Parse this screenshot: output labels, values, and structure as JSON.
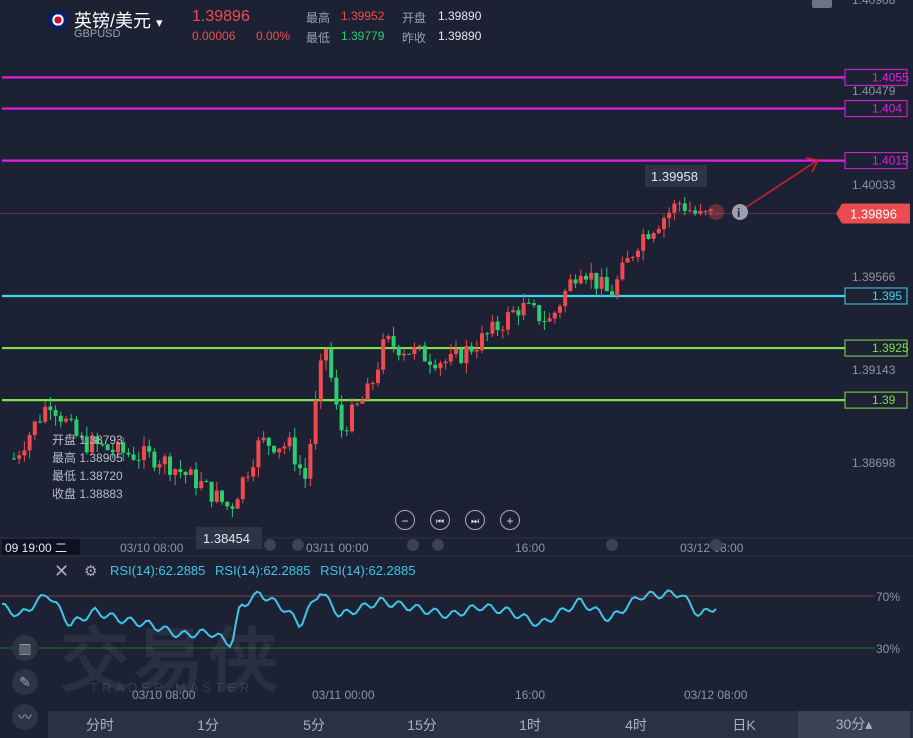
{
  "header": {
    "symbol_name": "英镑/美元",
    "symbol_dropdown": "▾",
    "symbol_code": "GBPUSD",
    "last_price": "1.39896",
    "change": "0.00006",
    "change_pct": "0.00%",
    "high_label": "最高",
    "high_value": "1.39952",
    "low_label": "最低",
    "low_value": "1.39779",
    "open_label": "开盘",
    "open_value": "1.39890",
    "prev_close_label": "昨收",
    "prev_close_value": "1.39890"
  },
  "crosshair_ohlc": {
    "open": "开盘 1.38793",
    "high": "最高 1.38905",
    "low": "最低 1.38720",
    "close": "收盘 1.38883"
  },
  "price_axis": {
    "tick_labels": [
      "1.40908",
      "1.40479",
      "1.40033",
      "1.39566",
      "1.39143",
      "1.38698"
    ],
    "current_price_tag": "1.39896"
  },
  "horizontal_lines": [
    {
      "label": "1.4055",
      "color": "#e020e0"
    },
    {
      "label": "1.404",
      "color": "#e020e0"
    },
    {
      "label": "1.4015",
      "color": "#e020e0"
    },
    {
      "label": "1.395",
      "color": "#3ed6f0"
    },
    {
      "label": "1.3925",
      "color": "#7ee04a"
    },
    {
      "label": "1.39",
      "color": "#7ee04a"
    }
  ],
  "annotations": {
    "high_marker": "1.39958",
    "low_marker": "1.38454"
  },
  "time_axis": {
    "cursor_label": "09 19:00 二",
    "labels": [
      "03/10 08:00",
      "03/11 00:00",
      "16:00",
      "03/12 08:00"
    ]
  },
  "chart_controls": {
    "zoom_out": "−",
    "prev": "⏮",
    "next": "⏭",
    "zoom_in": "+"
  },
  "indicator": {
    "close_icon": "close-icon",
    "settings_icon": "gear-icon",
    "rsi_labels": [
      "RSI(14):62.2885",
      "RSI(14):62.2885",
      "RSI(14):62.2885"
    ],
    "level_high": "70%",
    "level_low": "30%",
    "time_labels": [
      "03/10 08:00",
      "03/11 00:00",
      "16:00",
      "03/12 08:00"
    ],
    "line_color": "#3ec6e6"
  },
  "watermark": {
    "main": "交易侠",
    "sub": "TRADER MASTER"
  },
  "timeframes": {
    "items": [
      "分时",
      "1分",
      "5分",
      "15分",
      "1时",
      "4时",
      "日K"
    ],
    "active": "30分▴"
  },
  "colors": {
    "up": "#f04a4f",
    "down": "#2ecc71",
    "bg": "#1c2233"
  }
}
